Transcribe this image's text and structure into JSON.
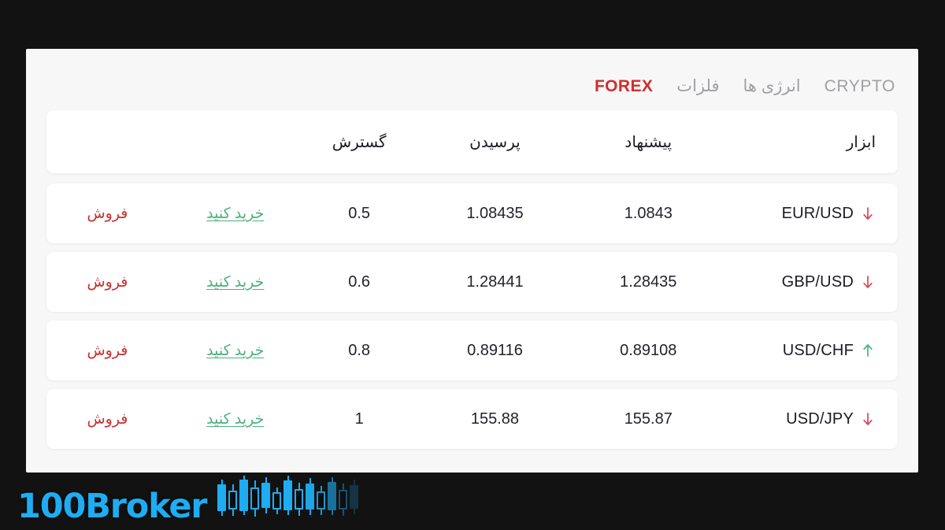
{
  "tabs": [
    {
      "label": "CRYPTO",
      "script": "latin",
      "active": false,
      "name": "tab-crypto"
    },
    {
      "label": "انرژی ها",
      "script": "arabic",
      "active": false,
      "name": "tab-energy"
    },
    {
      "label": "فلزات",
      "script": "arabic",
      "active": false,
      "name": "tab-metals"
    },
    {
      "label": "FOREX",
      "script": "latin",
      "active": true,
      "name": "tab-forex"
    }
  ],
  "table": {
    "columns": {
      "instrument": "ابزار",
      "bid": "پیشنهاد",
      "ask": "پرسیدن",
      "spread": "گسترش",
      "buy": "",
      "sell": ""
    },
    "rows": [
      {
        "instrument": "EUR/USD",
        "trend": "down",
        "bid": "1.0843",
        "ask": "1.08435",
        "spread": "0.5",
        "buy_label": "خرید کنید",
        "sell_label": "فروش"
      },
      {
        "instrument": "GBP/USD",
        "trend": "down",
        "bid": "1.28435",
        "ask": "1.28441",
        "spread": "0.6",
        "buy_label": "خرید کنید",
        "sell_label": "فروش"
      },
      {
        "instrument": "USD/CHF",
        "trend": "up",
        "bid": "0.89108",
        "ask": "0.89116",
        "spread": "0.8",
        "buy_label": "خرید کنید",
        "sell_label": "فروش"
      },
      {
        "instrument": "USD/JPY",
        "trend": "down",
        "bid": "155.87",
        "ask": "155.88",
        "spread": "1",
        "buy_label": "خرید کنید",
        "sell_label": "فروش"
      }
    ]
  },
  "watermark": {
    "text": "100Broker",
    "icon": "candlestick-chart-icon"
  },
  "colors": {
    "active_tab": "#d32d2d",
    "inactive_tab": "#a0a0a4",
    "buy_green": "#4cb07f",
    "sell_red": "#c93030",
    "trend_up": "#4cb07f",
    "trend_down": "#d9455a",
    "card_bg": "#f7f7f8",
    "row_bg": "#ffffff",
    "page_bg": "#121212",
    "watermark_blue": "#1eadf2"
  }
}
